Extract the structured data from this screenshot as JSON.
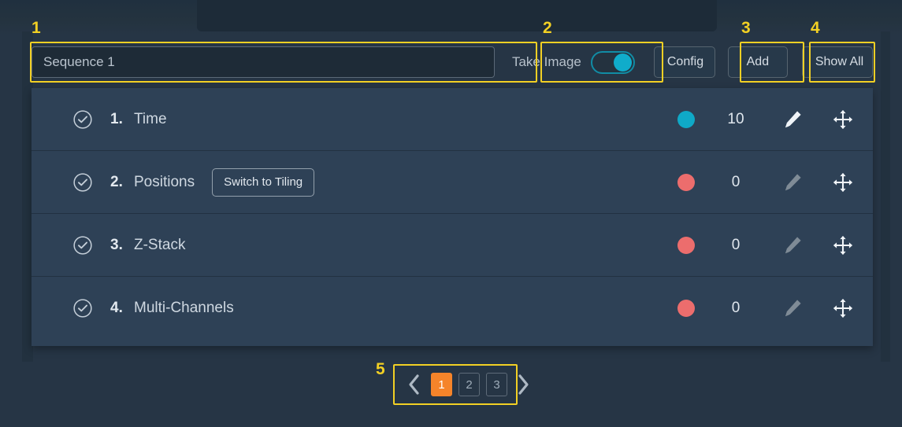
{
  "sequence_input": {
    "value": "Sequence 1",
    "placeholder": "Sequence 1"
  },
  "toolbar": {
    "take_image_label": "Take Image",
    "take_image_on": true,
    "config_label": "Config",
    "add_label": "Add",
    "show_all_label": "Show All"
  },
  "list": {
    "rows": [
      {
        "index": "1.",
        "label": "Time",
        "action_button": null,
        "dot_color": "#0fa9c7",
        "count": "10",
        "edit_enabled": true
      },
      {
        "index": "2.",
        "label": "Positions",
        "action_button": "Switch to Tiling",
        "dot_color": "#ec6d6d",
        "count": "0",
        "edit_enabled": false
      },
      {
        "index": "3.",
        "label": "Z-Stack",
        "action_button": null,
        "dot_color": "#ec6d6d",
        "count": "0",
        "edit_enabled": false
      },
      {
        "index": "4.",
        "label": "Multi-Channels",
        "action_button": null,
        "dot_color": "#ec6d6d",
        "count": "0",
        "edit_enabled": false
      }
    ]
  },
  "pagination": {
    "prev_label": "‹",
    "next_label": "›",
    "pages": [
      "1",
      "2",
      "3"
    ],
    "active_page": "1"
  },
  "annotations": {
    "items": [
      {
        "number": "1"
      },
      {
        "number": "2"
      },
      {
        "number": "3"
      },
      {
        "number": "4"
      },
      {
        "number": "5"
      }
    ],
    "color": "#f2d024"
  },
  "colors": {
    "page_background": "#263545",
    "list_panel": "#2e4156",
    "accent_cyan": "#10accb",
    "status_active": "#0fa9c7",
    "status_inactive": "#ec6d6d",
    "pagination_active": "#f5842a",
    "annotation": "#f2d024"
  }
}
